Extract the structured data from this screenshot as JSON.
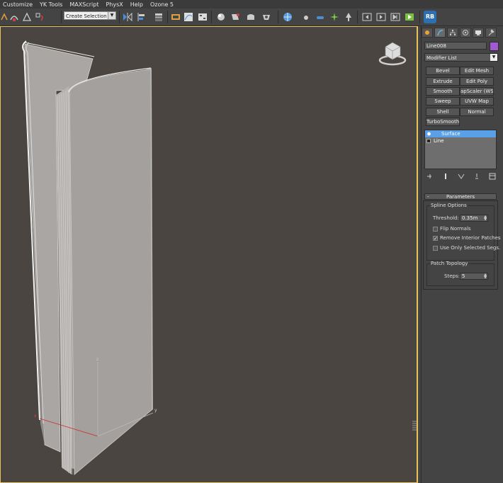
{
  "menu": {
    "items": [
      "Customize",
      "YK Tools",
      "MAXScript",
      "PhysX",
      "Help",
      "Ozone 5"
    ]
  },
  "toolbar": {
    "selection_set_placeholder": "Create Selection Se",
    "badge": "RB"
  },
  "viewport": {
    "axis_z": "z",
    "axis_x": "x",
    "axis_y": "y"
  },
  "panel": {
    "object_name": "Line008",
    "object_color": "#a05ad2",
    "modifier_list": "Modifier List",
    "modifier_buttons": [
      "Bevel",
      "Edit Mesh",
      "Extrude",
      "Edit Poly",
      "Smooth",
      "apScaler (WSM",
      "Sweep",
      "UVW Map",
      "Shell",
      "Normal",
      "TurboSmooth"
    ],
    "stack": {
      "items": [
        "Surface",
        "Line"
      ]
    },
    "parameters": {
      "title": "Parameters",
      "spline_options": "Spline Options",
      "threshold_label": "Threshold:",
      "threshold_value": "0.35m",
      "flip_normals": {
        "label": "Flip Normals",
        "checked": false
      },
      "remove_interior": {
        "label": "Remove Interior Patches",
        "checked": true
      },
      "use_only_selected": {
        "label": "Use Only Selected Segs.",
        "checked": false
      },
      "patch_topology": "Patch Topology",
      "steps_label": "Steps:",
      "steps_value": "5"
    }
  }
}
